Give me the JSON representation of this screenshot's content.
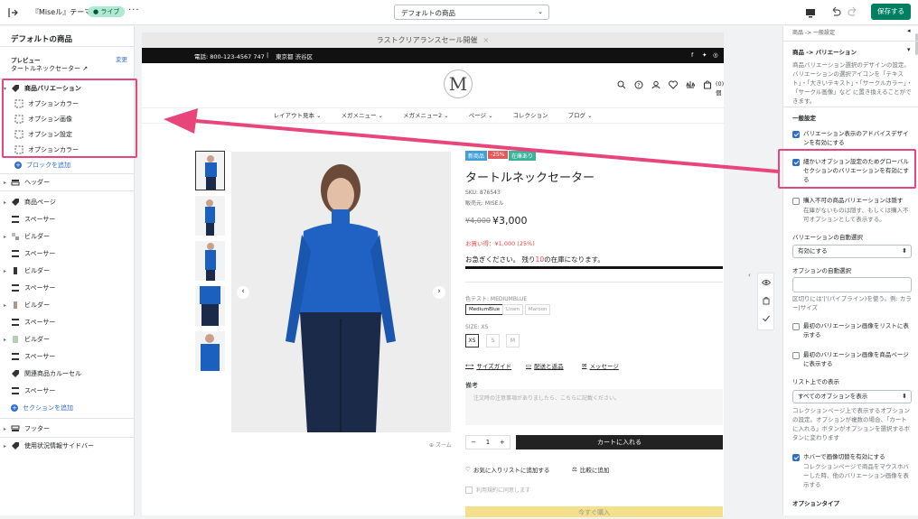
{
  "topbar": {
    "theme_name": "『Miseル』テーマ",
    "live_badge": "ライブ",
    "more": "···",
    "template_select": "デフォルトの商品",
    "save_label": "保存する"
  },
  "left": {
    "title": "デフォルトの商品",
    "preview_label": "プレビュー",
    "change_label": "変更",
    "preview_product": "タートルネックセーター",
    "tree": [
      {
        "label": "商品バリエーション"
      },
      {
        "label": "オプションカラー"
      },
      {
        "label": "オプション画像"
      },
      {
        "label": "オプション設定"
      },
      {
        "label": "オプションカラー"
      },
      {
        "label": "ブロックを追加"
      },
      {
        "label": "ヘッダー"
      },
      {
        "label": "商品ページ"
      },
      {
        "label": "スペーサー"
      },
      {
        "label": "ビルダー"
      },
      {
        "label": "スペーサー"
      },
      {
        "label": "ビルダー"
      },
      {
        "label": "スペーサー"
      },
      {
        "label": "ビルダー"
      },
      {
        "label": "スペーサー"
      },
      {
        "label": "ビルダー"
      },
      {
        "label": "スペーサー"
      },
      {
        "label": "関連商品カルーセル"
      },
      {
        "label": "スペーサー"
      },
      {
        "label": "セクションを追加"
      },
      {
        "label": "フッター"
      },
      {
        "label": "使用状況情報サイドバー"
      }
    ]
  },
  "preview": {
    "announcement": "ラストクリアランスセール開催",
    "announcement_close": "×",
    "phone": "電話: 800-123-4567 747",
    "divider": "|",
    "address": "東京都 渋谷区",
    "logo": "M",
    "cart_count": "(0)個",
    "nav": [
      "レイアウト見本 ⌄",
      "メガメニュー ⌄",
      "メガメニュー2 ⌄",
      "ページ ⌄",
      "コレクション",
      "ブログ ⌄"
    ],
    "badges": [
      "新商品",
      "-25%",
      "在庫あり"
    ],
    "product_title": "タートルネックセーター",
    "sku": "SKU: 876543",
    "vendor": "販売元: MISEル",
    "old_price": "¥4,000",
    "new_price": "¥3,000",
    "savings": "お買い得：¥1,000 (25%)",
    "hurry_pre": "お急ぎください。 残り",
    "hurry_num": "10",
    "hurry_post": "の在庫になります。",
    "color_label": "色テスト: MEDIUMBLUE",
    "colors": [
      "MediumBlue",
      "Linen",
      "Maroon"
    ],
    "size_label": "SIZE: XS",
    "sizes": [
      "XS",
      "S",
      "M"
    ],
    "size_guide": "サイズガイド",
    "shipping": "配送と返品",
    "message": "メッセージ",
    "note_label": "備考",
    "note_placeholder": "注文時の注意事項がありましたら、こちらに記載ください。",
    "qty_minus": "−",
    "qty_value": "1",
    "qty_plus": "+",
    "add_to_cart": "カートに入れる",
    "wishlist": "お気に入りリストに追加する",
    "compare": "比較に追加",
    "terms": "利用規約に同意します",
    "buy_now": "今すぐ購入",
    "zoom": "ズーム"
  },
  "right": {
    "breadcrumb_top": "商品 -> 一般設定",
    "breadcrumb": "商品 -> バリエーション",
    "intro": "商品バリエーション選択のデザインの設定。バリエーションの選択アイコンを「テキスト」・「大きいテキスト」・「サークルカラー」・「サークル画像」など に置き換えることができます。",
    "general_heading": "一般設定",
    "cb_advanced": "バリエーション表示のアドバイスデザインを有効にする",
    "cb_global": "細かいオプション設定のためグローバルセクションのバリエーションを有効にする",
    "cb_hide_unavailable": "購入不可の商品バリエーションは隠す",
    "cb_hide_unavailable_sub": "在庫がないものは隠す、もしくは購入不可オプションとして表示する。",
    "auto_select_label": "バリエーションの自動選択",
    "auto_select_value": "有効にする",
    "option_auto_label": "オプションの自動選択",
    "option_auto_help": "区切りには'|'(パイプライン)を使う。例: カラー|サイズ",
    "cb_first_list": "最初のバリエーション画像をリストに表示する",
    "cb_first_page": "最初のバリエーション画像を商品ページに表示する",
    "list_display_label": "リスト上での表示",
    "list_display_value": "すべてのオプションを表示",
    "list_display_help": "コレクションページ上で表示するオプションの設定。オプションが複数の場合、「カートに入れる」ボタンがオプションを選択するボタンに変わります",
    "cb_hover": "ホバーで画像切替を有効にする",
    "cb_hover_sub": "コレクションページで商品をマウスホバーした時、他のバリエーション画像を表示する",
    "option_type_heading": "オプションタイプ"
  },
  "colors": {
    "accent_green": "#008060",
    "highlight_pink": "#e8457a",
    "link_blue": "#2c6ecb"
  }
}
